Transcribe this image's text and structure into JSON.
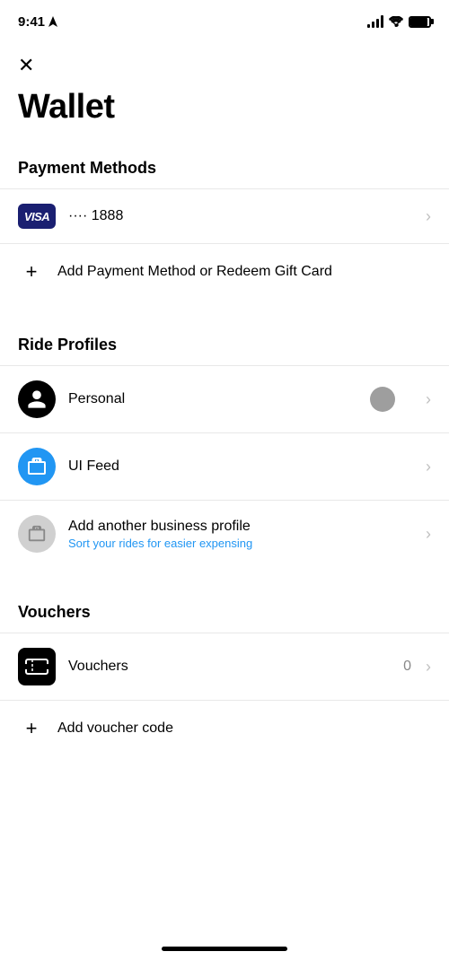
{
  "statusBar": {
    "time": "9:41",
    "locationArrow": true
  },
  "closeButton": {
    "label": "×"
  },
  "pageTitle": "Wallet",
  "paymentMethods": {
    "sectionLabel": "Payment Methods",
    "items": [
      {
        "type": "visa",
        "label": "···· 1888",
        "iconLabel": "VISA"
      },
      {
        "type": "add",
        "label": "Add Payment Method or Redeem Gift Card"
      }
    ]
  },
  "rideProfiles": {
    "sectionLabel": "Ride Profiles",
    "items": [
      {
        "type": "personal",
        "label": "Personal"
      },
      {
        "type": "business",
        "label": "UI Feed"
      },
      {
        "type": "add-business",
        "label": "Add another business profile",
        "sublabel": "Sort your rides for easier expensing"
      }
    ]
  },
  "vouchers": {
    "sectionLabel": "Vouchers",
    "items": [
      {
        "type": "voucher",
        "label": "Vouchers",
        "count": "0"
      },
      {
        "type": "add",
        "label": "Add voucher code"
      }
    ]
  }
}
